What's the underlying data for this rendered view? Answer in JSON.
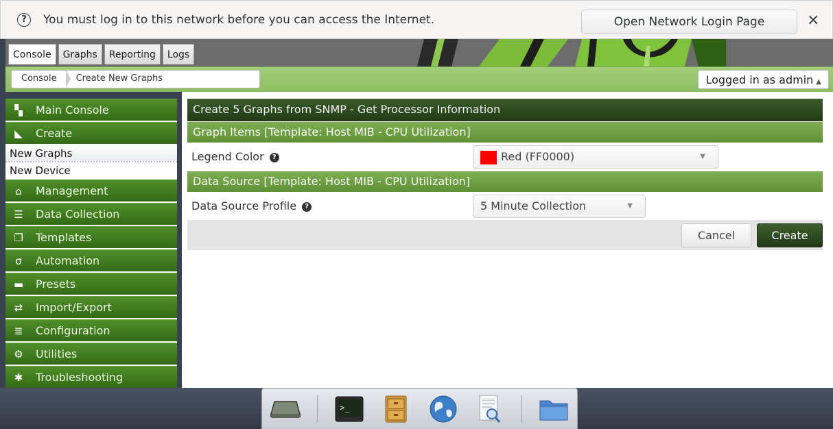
{
  "notification": {
    "message": "You must log in to this network before you can access the Internet.",
    "button": "Open Network Login Page",
    "close": "×"
  },
  "tabs": [
    {
      "label": "Console"
    },
    {
      "label": "Graphs"
    },
    {
      "label": "Reporting"
    },
    {
      "label": "Logs"
    }
  ],
  "breadcrumbs": [
    "Console",
    "Create New Graphs"
  ],
  "user": {
    "label": "Logged in as admin",
    "caret": "▲"
  },
  "sidebar": {
    "items": [
      {
        "label": "Main Console",
        "icon": "map-icon"
      },
      {
        "label": "Create",
        "icon": "chart-icon"
      },
      {
        "label": "New Graphs",
        "sub": true,
        "active": true
      },
      {
        "label": "New Device",
        "sub": true
      },
      {
        "label": "Management",
        "icon": "home-icon"
      },
      {
        "label": "Data Collection",
        "icon": "database-icon"
      },
      {
        "label": "Templates",
        "icon": "templates-icon"
      },
      {
        "label": "Automation",
        "icon": "automation-icon"
      },
      {
        "label": "Presets",
        "icon": "archive-icon"
      },
      {
        "label": "Import/Export",
        "icon": "exchange-icon"
      },
      {
        "label": "Configuration",
        "icon": "sliders-icon"
      },
      {
        "label": "Utilities",
        "icon": "cogs-icon"
      },
      {
        "label": "Troubleshooting",
        "icon": "bug-icon"
      }
    ]
  },
  "main": {
    "title": "Create 5 Graphs from SNMP - Get Processor Information",
    "graph_items_header": "Graph Items [Template: Host MIB - CPU Utilization]",
    "legend_color_label": "Legend Color",
    "legend_color_value": "Red (FF0000)",
    "legend_color_hex": "#FF0000",
    "data_source_header": "Data Source [Template: Host MIB - CPU Utilization]",
    "data_source_profile_label": "Data Source Profile",
    "data_source_profile_value": "5 Minute Collection",
    "cancel": "Cancel",
    "create": "Create"
  },
  "dock": {
    "icons": [
      "drive-icon",
      "terminal-icon",
      "file-cabinet-icon",
      "globe-icon",
      "document-search-icon",
      "folder-icon"
    ]
  },
  "colors": {
    "accent_green": "#346a16",
    "header_green": "#7eae53",
    "title_dark": "#2c4a1f"
  }
}
